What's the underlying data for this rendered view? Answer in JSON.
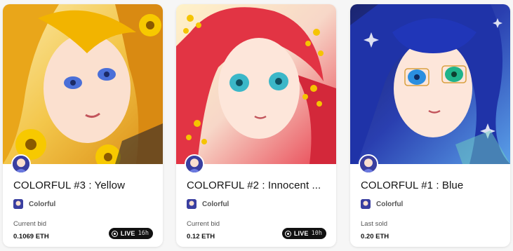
{
  "cards": [
    {
      "title": "COLORFUL #3 : Yellow",
      "creator": "Colorful",
      "price_label": "Current bid",
      "price": "0.1069 ETH",
      "live_label": "LIVE",
      "time_left": "16h"
    },
    {
      "title": "COLORFUL #2 : Innocent ...",
      "creator": "Colorful",
      "price_label": "Current bid",
      "price": "0.12 ETH",
      "live_label": "LIVE",
      "time_left": "10h"
    },
    {
      "title": "COLORFUL #1 : Blue",
      "creator": "Colorful",
      "price_label": "Last sold",
      "price": "0.20 ETH"
    }
  ],
  "colors": {
    "card_background": "#ffffff",
    "page_background": "#f6f6f6",
    "badge_background": "#111111",
    "art_yellow": "#f2b400",
    "art_red": "#e8404f",
    "art_blue": "#2a3fb0"
  }
}
